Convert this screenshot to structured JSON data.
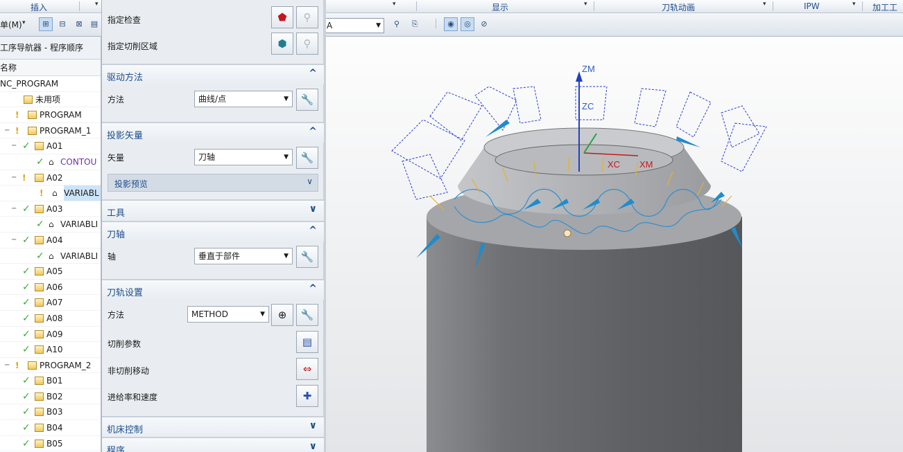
{
  "ribbon": {
    "groups": [
      "插入",
      "显示",
      "刀轨动画",
      "IPW",
      "加工工具"
    ]
  },
  "toolbar": {
    "menu_label": "单(M)",
    "select_value": "A"
  },
  "navigator": {
    "title": "工序导航器 - 程序顺序",
    "column": "名称",
    "rows": [
      {
        "label": "NC_PROGRAM"
      },
      {
        "label": "未用项"
      },
      {
        "label": "PROGRAM"
      },
      {
        "label": "PROGRAM_1"
      },
      {
        "label": "A01"
      },
      {
        "label": "CONTOU"
      },
      {
        "label": "A02"
      },
      {
        "label": "VARIABL"
      },
      {
        "label": "A03"
      },
      {
        "label": "VARIABLI"
      },
      {
        "label": "A04"
      },
      {
        "label": "VARIABLI"
      },
      {
        "label": "A05"
      },
      {
        "label": "A06"
      },
      {
        "label": "A07"
      },
      {
        "label": "A08"
      },
      {
        "label": "A09"
      },
      {
        "label": "A10"
      },
      {
        "label": "PROGRAM_2"
      },
      {
        "label": "B01"
      },
      {
        "label": "B02"
      },
      {
        "label": "B03"
      },
      {
        "label": "B04"
      },
      {
        "label": "B05"
      }
    ]
  },
  "dialog": {
    "specify_check": "指定检查",
    "specify_cut_area": "指定切削区域",
    "drive_method": {
      "title": "驱动方法",
      "label": "方法",
      "value": "曲线/点"
    },
    "projection_vector": {
      "title": "投影矢量",
      "label": "矢量",
      "value": "刀轴",
      "preview": "投影预览"
    },
    "tool": {
      "title": "工具"
    },
    "tool_axis": {
      "title": "刀轴",
      "label": "轴",
      "value": "垂直于部件"
    },
    "path_settings": {
      "title": "刀轨设置",
      "method_label": "方法",
      "method_value": "METHOD",
      "cut_params": "切削参数",
      "non_cut_moves": "非切削移动",
      "feeds_speeds": "进给率和速度"
    },
    "machine_control": {
      "title": "机床控制"
    },
    "program": {
      "title": "程序"
    }
  },
  "viewport": {
    "axis_labels": {
      "zm": "ZM",
      "zc": "ZC",
      "xc": "XC",
      "xm": "XM"
    }
  },
  "colors": {
    "accent": "#1d4d8c",
    "check": "#3aa83a",
    "tool_path": "#2f8fd0",
    "part": "#6d6f72"
  }
}
